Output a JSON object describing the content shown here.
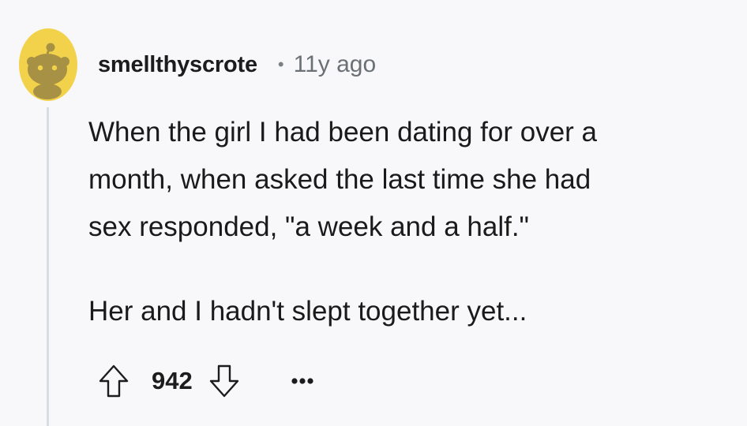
{
  "comment": {
    "username": "smellthyscrote",
    "separator": "•",
    "timestamp": "11y ago",
    "body": {
      "paragraph_1": "When the girl I had been dating for over a\nmonth, when asked the last time she had\nsex responded, \"a week and a half.\"",
      "paragraph_2": "Her and I hadn't slept together yet..."
    },
    "score": "942",
    "icons": {
      "avatar": "default-snoo-avatar-icon",
      "upvote": "arrow-up-icon",
      "downvote": "arrow-down-icon",
      "more": "ellipsis-icon"
    },
    "colors": {
      "background": "#f8f8fa",
      "avatar": "#f2d24a",
      "thread_line": "#d9dde2",
      "muted_text": "#6b7075"
    }
  }
}
